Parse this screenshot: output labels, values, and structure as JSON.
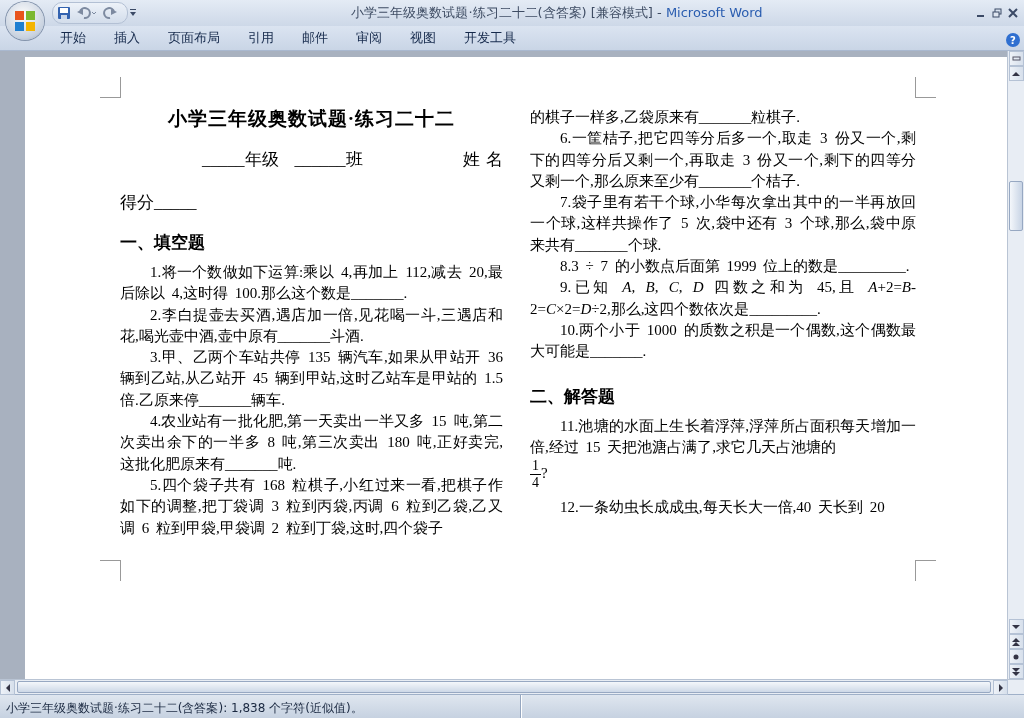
{
  "window": {
    "title": "小学三年级奥数试题·练习二十二(含答案) [兼容模式] -",
    "app_name": "Microsoft Word"
  },
  "ribbon_tabs": [
    {
      "label": "开始",
      "selected": false
    },
    {
      "label": "插入",
      "selected": false
    },
    {
      "label": "页面布局",
      "selected": false
    },
    {
      "label": "引用",
      "selected": false
    },
    {
      "label": "邮件",
      "selected": false
    },
    {
      "label": "审阅",
      "selected": false
    },
    {
      "label": "视图",
      "selected": false
    },
    {
      "label": "开发工具",
      "selected": false
    }
  ],
  "help_button": "?",
  "document": {
    "columns": [
      [
        {
          "kind": "title",
          "text": "小学三年级奥数试题·练习二十二"
        },
        {
          "kind": "fields",
          "items": [
            "_____年级",
            "______班",
            "姓名"
          ]
        },
        {
          "kind": "score",
          "text": "得分_____"
        },
        {
          "kind": "heading",
          "text": "一、填空题"
        },
        {
          "kind": "question",
          "text": "1.将一个数做如下运算:乘以 4,再加上 112,减去 20,最后除以 4,这时得 100.那么这个数是_______."
        },
        {
          "kind": "question",
          "text": "2.李白提壶去买酒,遇店加一倍,见花喝一斗,三遇店和花,喝光壶中酒,壶中原有_______斗酒."
        },
        {
          "kind": "question",
          "text": "3.甲、乙两个车站共停 135 辆汽车,如果从甲站开 36 辆到乙站,从乙站开 45 辆到甲站,这时乙站车是甲站的 1.5 倍.乙原来停_______辆车."
        },
        {
          "kind": "question",
          "text": "4.农业站有一批化肥,第一天卖出一半又多 15 吨,第二次卖出余下的一半多 8 吨,第三次卖出 180 吨,正好卖完,这批化肥原来有_______吨."
        },
        {
          "kind": "question",
          "text": "5.四个袋子共有 168 粒棋子,小红过来一看,把棋子作如下的调整,把丁袋调 3 粒到丙袋,丙调 6 粒到乙袋,乙又调 6 粒到甲袋,甲袋调 2 粒到丁袋,这时,四个袋子"
        }
      ],
      [
        {
          "kind": "continuation",
          "text": "的棋子一样多,乙袋原来有_______粒棋子."
        },
        {
          "kind": "question",
          "text": "6.一筐桔子,把它四等分后多一个,取走 3 份又一个,剩下的四等分后又剩一个,再取走 3 份又一个,剩下的四等分又剩一个,那么原来至少有_______个桔子."
        },
        {
          "kind": "question",
          "text": "7.袋子里有若干个球,小华每次拿出其中的一半再放回一个球,这样共操作了 5 次,袋中还有 3 个球,那么,袋中原来共有_______个球."
        },
        {
          "kind": "question",
          "text": "8.3 ÷ 7 的小数点后面第 1999 位上的数是_________."
        },
        {
          "kind": "question",
          "text": "9.已知 *A*, *B*, *C*, *D* 四数之和为 45,且 *A*+2=*B*-2=*C*×2=*D*÷2,那么,这四个数依次是_________."
        },
        {
          "kind": "question",
          "text": "10.两个小于 1000 的质数之积是一个偶数,这个偶数最大可能是_______."
        },
        {
          "kind": "empty"
        },
        {
          "kind": "heading",
          "text": "二、解答题"
        },
        {
          "kind": "question",
          "text": "11.池塘的水面上生长着浮萍,浮萍所占面积每天增加一倍,经过 15 天把池溏占满了,求它几天占池塘的",
          "fraction": {
            "numerator": "1",
            "denominator": "4"
          },
          "suffix": "?"
        },
        {
          "kind": "question",
          "text": "12.一条幼虫长成成虫,每天长大一倍,40 天长到 20"
        }
      ]
    ]
  },
  "status_bar": {
    "text": "小学三年级奥数试题·练习二十二(含答案): 1,838 个字符(近似值)。"
  }
}
